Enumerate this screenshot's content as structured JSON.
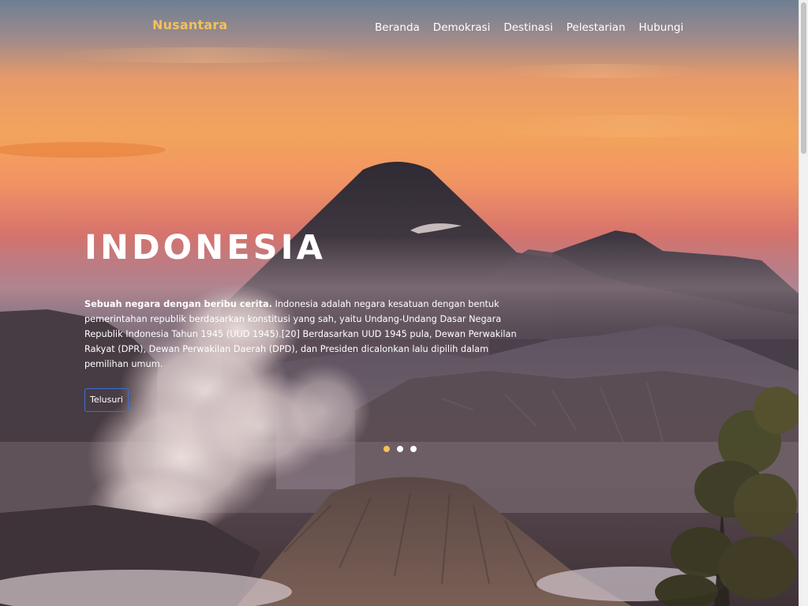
{
  "nav": {
    "brand": "Nusantara",
    "items": [
      {
        "label": "Beranda"
      },
      {
        "label": "Demokrasi"
      },
      {
        "label": "Destinasi"
      },
      {
        "label": "Pelestarian"
      },
      {
        "label": "Hubungi"
      }
    ]
  },
  "hero": {
    "title": "INDONESIA",
    "lead": "Sebuah negara dengan beribu cerita.",
    "body": " Indonesia adalah negara kesatuan dengan bentuk pemerintahan republik berdasarkan konstitusi yang sah, yaitu Undang-Undang Dasar Negara Republik Indonesia Tahun 1945 (UUD 1945).[20] Berdasarkan UUD 1945 pula, Dewan Perwakilan Rakyat (DPR), Dewan Perwakilan Daerah (DPD), dan Presiden dicalonkan lalu dipilih dalam pemilihan umum.",
    "button_label": "Telusuri"
  },
  "carousel": {
    "slide_count": 3,
    "active_index": 0,
    "active_color": "#f3c15b"
  },
  "colors": {
    "brand": "#f3c15b",
    "button_border": "#3b6fd8"
  },
  "icons": {
    "scene": "volcano-landscape-image"
  }
}
